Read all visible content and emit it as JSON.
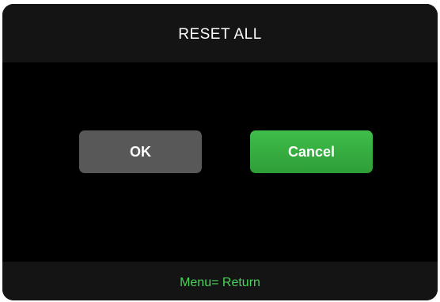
{
  "dialog": {
    "title": "RESET ALL",
    "buttons": {
      "ok_label": "OK",
      "cancel_label": "Cancel",
      "selected": "Cancel"
    },
    "footer_hint": "Menu= Return"
  },
  "colors": {
    "accent_selected": "#3cb043",
    "hint_text": "#49d35a",
    "unselected_button": "#585858"
  }
}
